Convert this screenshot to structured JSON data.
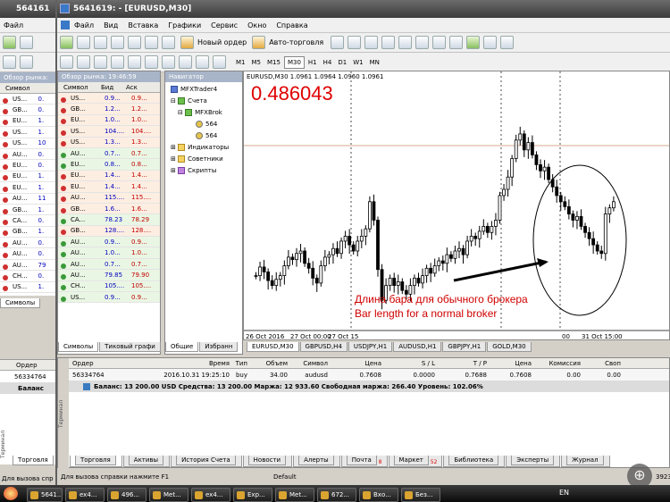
{
  "back_window": {
    "title": "564161",
    "menu": [
      "Файл"
    ],
    "market_watch_title": "Обзор рынка:",
    "col_symbol": "Символ",
    "symbols": [
      "US...",
      "GB...",
      "EU...",
      "US...",
      "US...",
      "AU...",
      "EU...",
      "EU...",
      "EU...",
      "AU...",
      "GB...",
      "CA...",
      "GB...",
      "AU...",
      "AU...",
      "AU...",
      "CH...",
      "US..."
    ],
    "values": [
      "0.",
      "0.",
      "1.",
      "1.",
      "10",
      "0.",
      "0.",
      "1.",
      "1.",
      "11",
      "1.",
      "0.",
      "1.",
      "0.",
      "0.",
      "79",
      "0.",
      "1."
    ],
    "tab_symbols": "Символы",
    "order_header": "Ордер",
    "order_value": "56334764",
    "balance_label": "Баланс",
    "tab_trading": "Торговля",
    "status_left": "Для вызова спр",
    "side_label": "Терминал"
  },
  "window": {
    "title": "5641619:                  - [EURUSD,M30]",
    "menu": [
      "Файл",
      "Вид",
      "Вставка",
      "Графики",
      "Сервис",
      "Окно",
      "Справка"
    ],
    "toolbar": {
      "new_order": "Новый ордер",
      "auto_trading": "Авто-торговля"
    },
    "timeframes": [
      "M1",
      "M5",
      "M15",
      "M30",
      "H1",
      "H4",
      "D1",
      "W1",
      "MN"
    ],
    "active_timeframe": "M30"
  },
  "market_watch": {
    "title": "Обзор рынка: 19:46:59",
    "columns": [
      "Символ",
      "Бид",
      "Аск"
    ],
    "rows": [
      {
        "symbol": "US...",
        "bid": "0.9...",
        "ask": "0.9...",
        "dir": "dn"
      },
      {
        "symbol": "GB...",
        "bid": "1.2...",
        "ask": "1.2...",
        "dir": "dn"
      },
      {
        "symbol": "EU...",
        "bid": "1.0...",
        "ask": "1.0...",
        "dir": "dn"
      },
      {
        "symbol": "US...",
        "bid": "104....",
        "ask": "104....",
        "dir": "dn"
      },
      {
        "symbol": "US...",
        "bid": "1.3...",
        "ask": "1.3...",
        "dir": "dn"
      },
      {
        "symbol": "AU...",
        "bid": "0.7...",
        "ask": "0.7...",
        "dir": "up"
      },
      {
        "symbol": "EU...",
        "bid": "0.8...",
        "ask": "0.8...",
        "dir": "up"
      },
      {
        "symbol": "EU...",
        "bid": "1.4...",
        "ask": "1.4...",
        "dir": "dn"
      },
      {
        "symbol": "EU...",
        "bid": "1.4...",
        "ask": "1.4...",
        "dir": "dn"
      },
      {
        "symbol": "AU...",
        "bid": "115....",
        "ask": "115....",
        "dir": "dn"
      },
      {
        "symbol": "GB...",
        "bid": "1.6...",
        "ask": "1.6...",
        "dir": "dn"
      },
      {
        "symbol": "CA...",
        "bid": "78.23",
        "ask": "78.29",
        "dir": "up"
      },
      {
        "symbol": "GB...",
        "bid": "128....",
        "ask": "128....",
        "dir": "dn"
      },
      {
        "symbol": "AU...",
        "bid": "0.9...",
        "ask": "0.9...",
        "dir": "up"
      },
      {
        "symbol": "AU...",
        "bid": "1.0...",
        "ask": "1.0...",
        "dir": "up"
      },
      {
        "symbol": "AU...",
        "bid": "0.7...",
        "ask": "0.7...",
        "dir": "up"
      },
      {
        "symbol": "AU...",
        "bid": "79.85",
        "ask": "79.90",
        "dir": "up"
      },
      {
        "symbol": "CH...",
        "bid": "105....",
        "ask": "105....",
        "dir": "up"
      },
      {
        "symbol": "US...",
        "bid": "0.9...",
        "ask": "0.9...",
        "dir": "up"
      }
    ],
    "tabs": [
      "Символы",
      "Тиковый графи"
    ]
  },
  "navigator": {
    "title": "Навигатор",
    "items": {
      "root": "MFXTrader4",
      "accounts": "Счета",
      "broker": "MFXBrok",
      "acc1": "564",
      "acc2": "564",
      "indicators": "Индикаторы",
      "advisors": "Советники",
      "scripts": "Скрипты"
    },
    "tabs": [
      "Общие",
      "Избранн"
    ]
  },
  "chart": {
    "symbol_line": "EURUSD,M30  1.0961 1.0964 1.0960 1.0961",
    "big_value": "0.486043",
    "annotation_ru": "Длина бара для обычного брокера",
    "annotation_en": "Bar length for a normal broker",
    "time_labels": [
      "26 Oct 2016",
      "27 Oct 00:00",
      "27 Oct 15",
      "00",
      "31 Oct 15:00"
    ],
    "tabs": [
      "EURUSD,M30",
      "GBPUSD,H4",
      "USDJPY,H1",
      "AUDUSD,H1",
      "GBPJPY,H1",
      "GOLD,M30"
    ],
    "active_tab": "EURUSD,M30",
    "colors": {
      "bg": "#ffffff",
      "candle": "#000000",
      "price_line": "#d9a98f",
      "big_value": "#e00000",
      "annotation": "#d00000"
    }
  },
  "chart_data": {
    "type": "candlestick",
    "closes": [
      30,
      37,
      33,
      26,
      22,
      27,
      30,
      38,
      45,
      43,
      48,
      50,
      40,
      36,
      28,
      24,
      38,
      45,
      47,
      52,
      48,
      58,
      62,
      55,
      50,
      58,
      62,
      68,
      90,
      75,
      35,
      10,
      22,
      28,
      22,
      25,
      18,
      15,
      22,
      28,
      24,
      30,
      36,
      32,
      38,
      42,
      40,
      47,
      44,
      50,
      52,
      47,
      58,
      62,
      60,
      66,
      70,
      65,
      70,
      75,
      95,
      100,
      110,
      125,
      140,
      145,
      132,
      138,
      128,
      120,
      115,
      118,
      108,
      102,
      95,
      90,
      86,
      80,
      75,
      78,
      70,
      65,
      60,
      55,
      50,
      48,
      80,
      85,
      90
    ]
  },
  "terminal": {
    "columns": [
      "Ордер",
      "Время",
      "Тип",
      "Объем",
      "Символ",
      "Цена",
      "S / L",
      "T / P",
      "Цена",
      "Комиссия",
      "Своп"
    ],
    "order": {
      "id": "56334764",
      "time": "2016.10.31 19:25:10",
      "type": "buy",
      "volume": "34.00",
      "symbol": "audusd",
      "price": "0.7608",
      "sl": "0.0000",
      "tp": "0.7688",
      "cur_price": "0.7608",
      "commission": "0.00",
      "swap": "0.00"
    },
    "balance_line": "Баланс: 13 200.00 USD  Средства: 13 200.00  Маржа: 12 933.60  Свободная маржа: 266.40  Уровень: 102.06%",
    "tabs": [
      "Торговля",
      "Активы",
      "История Счета",
      "Новости",
      "Алерты",
      "Почта",
      "Маркет",
      "Библиотека",
      "Эксперты",
      "Журнал"
    ],
    "mail_count": "8",
    "market_count": "52",
    "side_label": "Терминал"
  },
  "status": {
    "help": "Для вызова справки нажмите F1",
    "profile": "Default",
    "right": "3923"
  },
  "taskbar": {
    "buttons": [
      "5641...",
      "ex4...",
      "496...",
      "Met...",
      "ex4...",
      "Exp...",
      "Met...",
      "672...",
      "Вхо...",
      "Без..."
    ],
    "lang": "EN"
  }
}
